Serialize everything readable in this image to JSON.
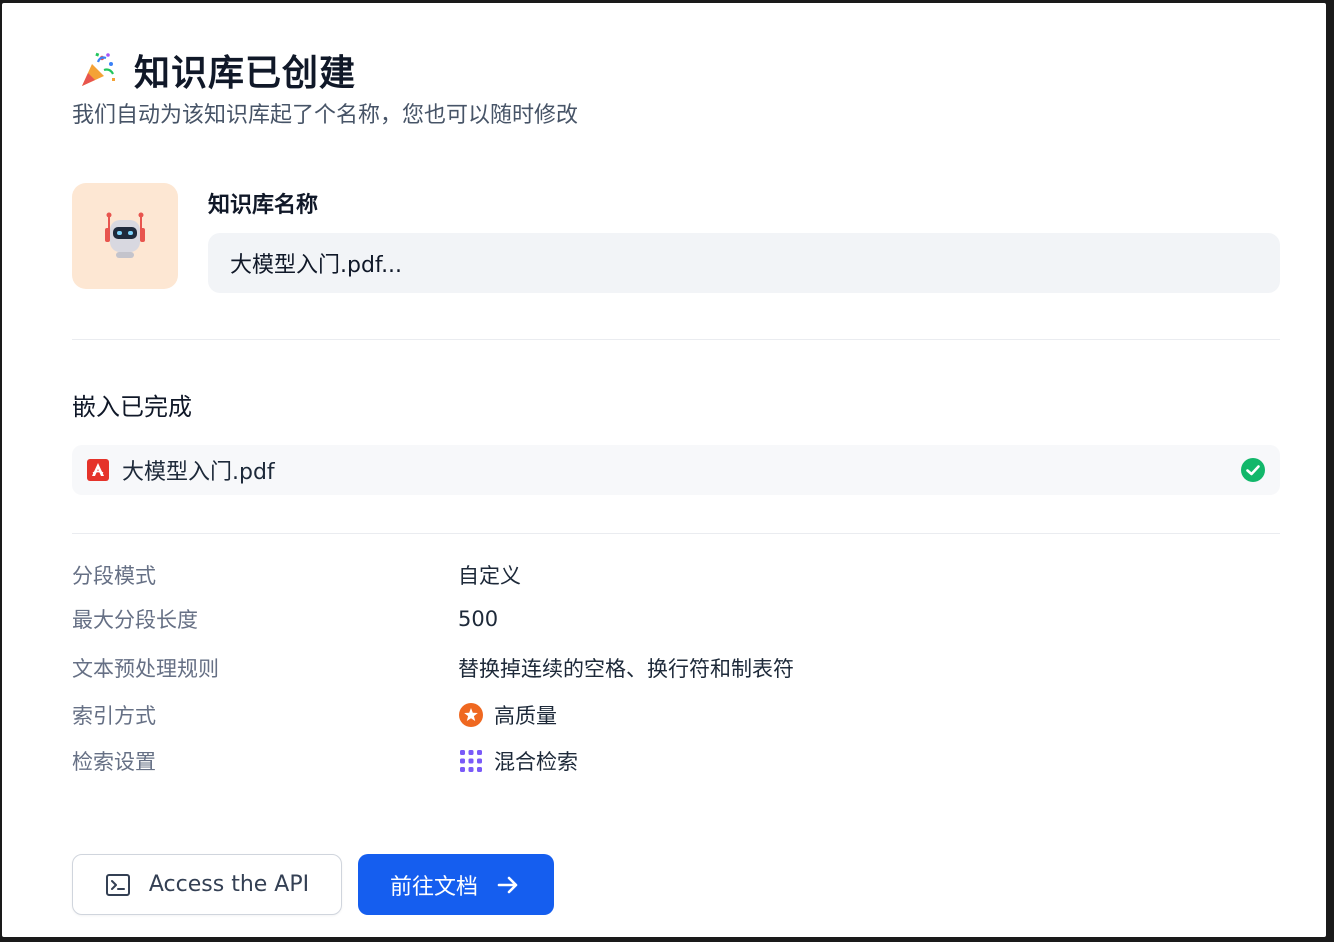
{
  "header": {
    "title": "知识库已创建",
    "subtitle": "我们自动为该知识库起了个名称，您也可以随时修改"
  },
  "dataset": {
    "name_label": "知识库名称",
    "name_value": "大模型入门.pdf..."
  },
  "embedding": {
    "section_title": "嵌入已完成",
    "files": [
      {
        "name": "大模型入门.pdf",
        "status": "completed"
      }
    ]
  },
  "settings": [
    {
      "label": "分段模式",
      "value": "自定义"
    },
    {
      "label": "最大分段长度",
      "value": "500"
    },
    {
      "label": "文本预处理规则",
      "value": "替换掉连续的空格、换行符和制表符"
    },
    {
      "label": "索引方式",
      "value": "高质量",
      "icon": "star-badge-icon"
    },
    {
      "label": "检索设置",
      "value": "混合检索",
      "icon": "grid-dots-icon"
    }
  ],
  "actions": {
    "api_label": "Access the API",
    "docs_label": "前往文档"
  },
  "colors": {
    "primary": "#155eef",
    "success": "#12b76a",
    "avatar_bg": "#fde7d3",
    "pdf_red": "#e5332a"
  }
}
